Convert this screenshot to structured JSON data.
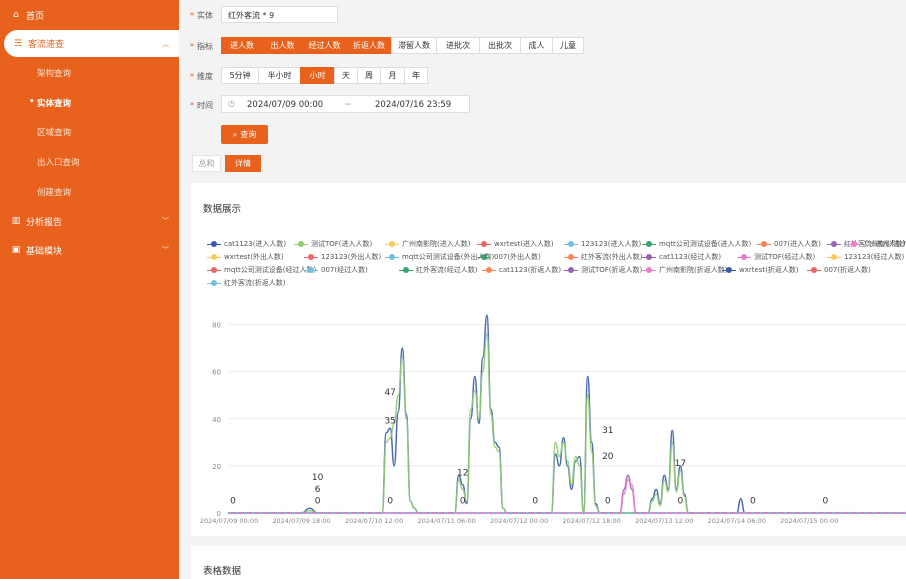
{
  "sidebar": {
    "home": "首页",
    "passenger": "客流速查",
    "subs": [
      "架构查询",
      "实体查询",
      "区域查询",
      "出入口查询",
      "创建查询"
    ],
    "analysis": "分析报告",
    "basic": "基础模块"
  },
  "form": {
    "entity_label": "实体",
    "entity_value": "红外客流 * 9",
    "metric_label": "指标",
    "metrics": [
      {
        "label": "进人数",
        "on": true
      },
      {
        "label": "出人数",
        "on": true
      },
      {
        "label": "经过人数",
        "on": true
      },
      {
        "label": "折返人数",
        "on": true
      },
      {
        "label": "滞留人数",
        "on": false
      },
      {
        "label": "进批次",
        "on": false
      },
      {
        "label": "出批次",
        "on": false
      },
      {
        "label": "成人",
        "on": false
      },
      {
        "label": "儿童",
        "on": false
      }
    ],
    "granularity_label": "维度",
    "granularity": [
      {
        "label": "5分钟",
        "on": false
      },
      {
        "label": "半小时",
        "on": false
      },
      {
        "label": "小时",
        "on": true
      },
      {
        "label": "天",
        "on": false
      },
      {
        "label": "周",
        "on": false
      },
      {
        "label": "月",
        "on": false
      },
      {
        "label": "年",
        "on": false
      }
    ],
    "time_label": "时间",
    "start": "2024/07/09 00:00",
    "separator": "~",
    "end": "2024/07/16 23:59",
    "query_button": "查询"
  },
  "tabs": {
    "summary": "总和",
    "detail": "详情"
  },
  "chart_card_title": "数据展示",
  "table_card_title": "表格数据",
  "legend": [
    {
      "name": "cat1123(进入人数)",
      "color": "#3b5aa9"
    },
    {
      "name": "测试TOF(进入人数)",
      "color": "#91cc75"
    },
    {
      "name": "广州南影院(进入人数)",
      "color": "#fac858"
    },
    {
      "name": "wxrtest(进入人数)",
      "color": "#ee6666"
    },
    {
      "name": "123123(进入人数)",
      "color": "#73c0de"
    },
    {
      "name": "mqtt公司测试设备(进入人数)",
      "color": "#3ba272"
    },
    {
      "name": "007(进入人数)",
      "color": "#fc8452"
    },
    {
      "name": "红外客流(进入人数)",
      "color": "#9a60b4"
    },
    {
      "name": "广州南影院(外出人数)",
      "color": "#ea7ccc"
    },
    {
      "name": "wxrtest(外出人数)",
      "color": "#fac858"
    },
    {
      "name": "123123(外出人数)",
      "color": "#ee6666"
    },
    {
      "name": "mqtt公司测试设备(外出人数)",
      "color": "#73c0de"
    },
    {
      "name": "007(外出人数)",
      "color": "#3ba272"
    },
    {
      "name": "红外客流(外出人数)",
      "color": "#fc8452"
    },
    {
      "name": "cat1123(经过人数)",
      "color": "#9a60b4"
    },
    {
      "name": "测试TOF(经过人数)",
      "color": "#ea7ccc"
    },
    {
      "name": "123123(经过人数)",
      "color": "#fac858"
    },
    {
      "name": "mqtt公司测试设备(经过人数)",
      "color": "#ee6666"
    },
    {
      "name": "007(经过人数)",
      "color": "#73c0de"
    },
    {
      "name": "红外客流(经过人数)",
      "color": "#3ba272"
    },
    {
      "name": "cat1123(折返人数)",
      "color": "#fc8452"
    },
    {
      "name": "测试TOF(折返人数)",
      "color": "#9a60b4"
    },
    {
      "name": "广州南影院(折返人数)",
      "color": "#ea7ccc"
    },
    {
      "name": "wxrtest(折返人数)",
      "color": "#3b5aa9"
    },
    {
      "name": "007(折返人数)",
      "color": "#ee6666"
    },
    {
      "name": "红外客流(折返人数)",
      "color": "#73c0de"
    }
  ],
  "chart_data": {
    "type": "line",
    "y_ticks": [
      0,
      20,
      40,
      60,
      80
    ],
    "ylim": [
      0,
      90
    ],
    "xlim_hours": [
      0,
      168
    ],
    "x_ticks": [
      {
        "label": "2024/07/09 00:00",
        "h": 0
      },
      {
        "label": "2024/07/09 18:00",
        "h": 18
      },
      {
        "label": "2024/07/10 12:00",
        "h": 36
      },
      {
        "label": "2024/07/11 06:00",
        "h": 54
      },
      {
        "label": "2024/07/12 00:00",
        "h": 72
      },
      {
        "label": "2024/07/12 18:00",
        "h": 90
      },
      {
        "label": "2024/07/13 12:00",
        "h": 108
      },
      {
        "label": "2024/07/14 06:00",
        "h": 126
      },
      {
        "label": "2024/07/15 00:00",
        "h": 144
      }
    ],
    "series": [
      {
        "name": "cat1123(进入人数)",
        "color": "#3b5aa9",
        "points": [
          [
            0,
            0
          ],
          [
            18,
            0
          ],
          [
            20,
            2
          ],
          [
            22,
            0
          ],
          [
            38,
            0
          ],
          [
            39,
            34
          ],
          [
            40,
            36
          ],
          [
            41,
            20
          ],
          [
            42,
            43
          ],
          [
            43,
            70
          ],
          [
            44,
            42
          ],
          [
            45,
            5
          ],
          [
            46,
            2
          ],
          [
            47,
            0
          ],
          [
            56,
            0
          ],
          [
            57,
            16
          ],
          [
            58,
            12
          ],
          [
            59,
            4
          ],
          [
            60,
            40
          ],
          [
            61,
            58
          ],
          [
            62,
            38
          ],
          [
            63,
            66
          ],
          [
            64,
            84
          ],
          [
            65,
            44
          ],
          [
            66,
            30
          ],
          [
            67,
            28
          ],
          [
            68,
            2
          ],
          [
            69,
            0
          ],
          [
            80,
            0
          ],
          [
            81,
            25
          ],
          [
            82,
            20
          ],
          [
            83,
            32
          ],
          [
            84,
            20
          ],
          [
            85,
            10
          ],
          [
            86,
            22
          ],
          [
            87,
            24
          ],
          [
            88,
            0
          ],
          [
            89,
            58
          ],
          [
            90,
            30
          ],
          [
            91,
            4
          ],
          [
            92,
            0
          ],
          [
            104,
            0
          ],
          [
            105,
            6
          ],
          [
            106,
            10
          ],
          [
            107,
            4
          ],
          [
            108,
            16
          ],
          [
            109,
            10
          ],
          [
            110,
            35
          ],
          [
            111,
            10
          ],
          [
            112,
            20
          ],
          [
            113,
            8
          ],
          [
            114,
            0
          ],
          [
            126,
            0
          ],
          [
            127,
            6
          ],
          [
            128,
            0
          ],
          [
            168,
            0
          ]
        ]
      },
      {
        "name": "测试TOF(进入人数)",
        "color": "#91cc75",
        "points": [
          [
            0,
            0
          ],
          [
            18,
            0
          ],
          [
            20,
            1
          ],
          [
            22,
            0
          ],
          [
            38,
            0
          ],
          [
            39,
            30
          ],
          [
            40,
            32
          ],
          [
            41,
            38
          ],
          [
            42,
            50
          ],
          [
            43,
            66
          ],
          [
            44,
            40
          ],
          [
            45,
            5
          ],
          [
            46,
            2
          ],
          [
            47,
            0
          ],
          [
            56,
            0
          ],
          [
            57,
            14
          ],
          [
            58,
            10
          ],
          [
            59,
            5
          ],
          [
            60,
            44
          ],
          [
            61,
            52
          ],
          [
            62,
            40
          ],
          [
            63,
            60
          ],
          [
            64,
            76
          ],
          [
            65,
            42
          ],
          [
            66,
            28
          ],
          [
            67,
            26
          ],
          [
            68,
            2
          ],
          [
            69,
            0
          ],
          [
            80,
            0
          ],
          [
            81,
            30
          ],
          [
            82,
            24
          ],
          [
            83,
            30
          ],
          [
            84,
            22
          ],
          [
            85,
            12
          ],
          [
            86,
            24
          ],
          [
            87,
            20
          ],
          [
            88,
            0
          ],
          [
            89,
            50
          ],
          [
            90,
            26
          ],
          [
            91,
            3
          ],
          [
            92,
            0
          ],
          [
            104,
            0
          ],
          [
            105,
            5
          ],
          [
            106,
            8
          ],
          [
            107,
            3
          ],
          [
            108,
            14
          ],
          [
            109,
            9
          ],
          [
            110,
            30
          ],
          [
            111,
            9
          ],
          [
            112,
            18
          ],
          [
            113,
            7
          ],
          [
            114,
            0
          ],
          [
            168,
            0
          ]
        ]
      },
      {
        "name": "cat1123(经过人数)",
        "color": "#9a60b4",
        "points": [
          [
            0,
            0
          ],
          [
            97,
            0
          ],
          [
            98,
            10
          ],
          [
            99,
            16
          ],
          [
            100,
            10
          ],
          [
            101,
            0
          ],
          [
            168,
            0
          ]
        ]
      },
      {
        "name": "测试TOF(经过人数)",
        "color": "#ea7ccc",
        "points": [
          [
            0,
            0
          ],
          [
            97,
            0
          ],
          [
            98,
            8
          ],
          [
            99,
            14
          ],
          [
            100,
            12
          ],
          [
            101,
            0
          ],
          [
            168,
            0
          ]
        ]
      }
    ],
    "labels": [
      {
        "text": "0",
        "h": 1,
        "v": 4
      },
      {
        "text": "10",
        "h": 22,
        "v": 14
      },
      {
        "text": "6",
        "h": 22,
        "v": 9
      },
      {
        "text": "0",
        "h": 22,
        "v": 4
      },
      {
        "text": "47",
        "h": 40,
        "v": 50
      },
      {
        "text": "35",
        "h": 40,
        "v": 38
      },
      {
        "text": "0",
        "h": 40,
        "v": 4
      },
      {
        "text": "12",
        "h": 58,
        "v": 16
      },
      {
        "text": "0",
        "h": 58,
        "v": 4
      },
      {
        "text": "0",
        "h": 76,
        "v": 4
      },
      {
        "text": "31",
        "h": 94,
        "v": 34
      },
      {
        "text": "20",
        "h": 94,
        "v": 23
      },
      {
        "text": "0",
        "h": 94,
        "v": 4
      },
      {
        "text": "17",
        "h": 112,
        "v": 20
      },
      {
        "text": "0",
        "h": 112,
        "v": 4
      },
      {
        "text": "0",
        "h": 130,
        "v": 4
      },
      {
        "text": "0",
        "h": 148,
        "v": 4
      }
    ]
  }
}
